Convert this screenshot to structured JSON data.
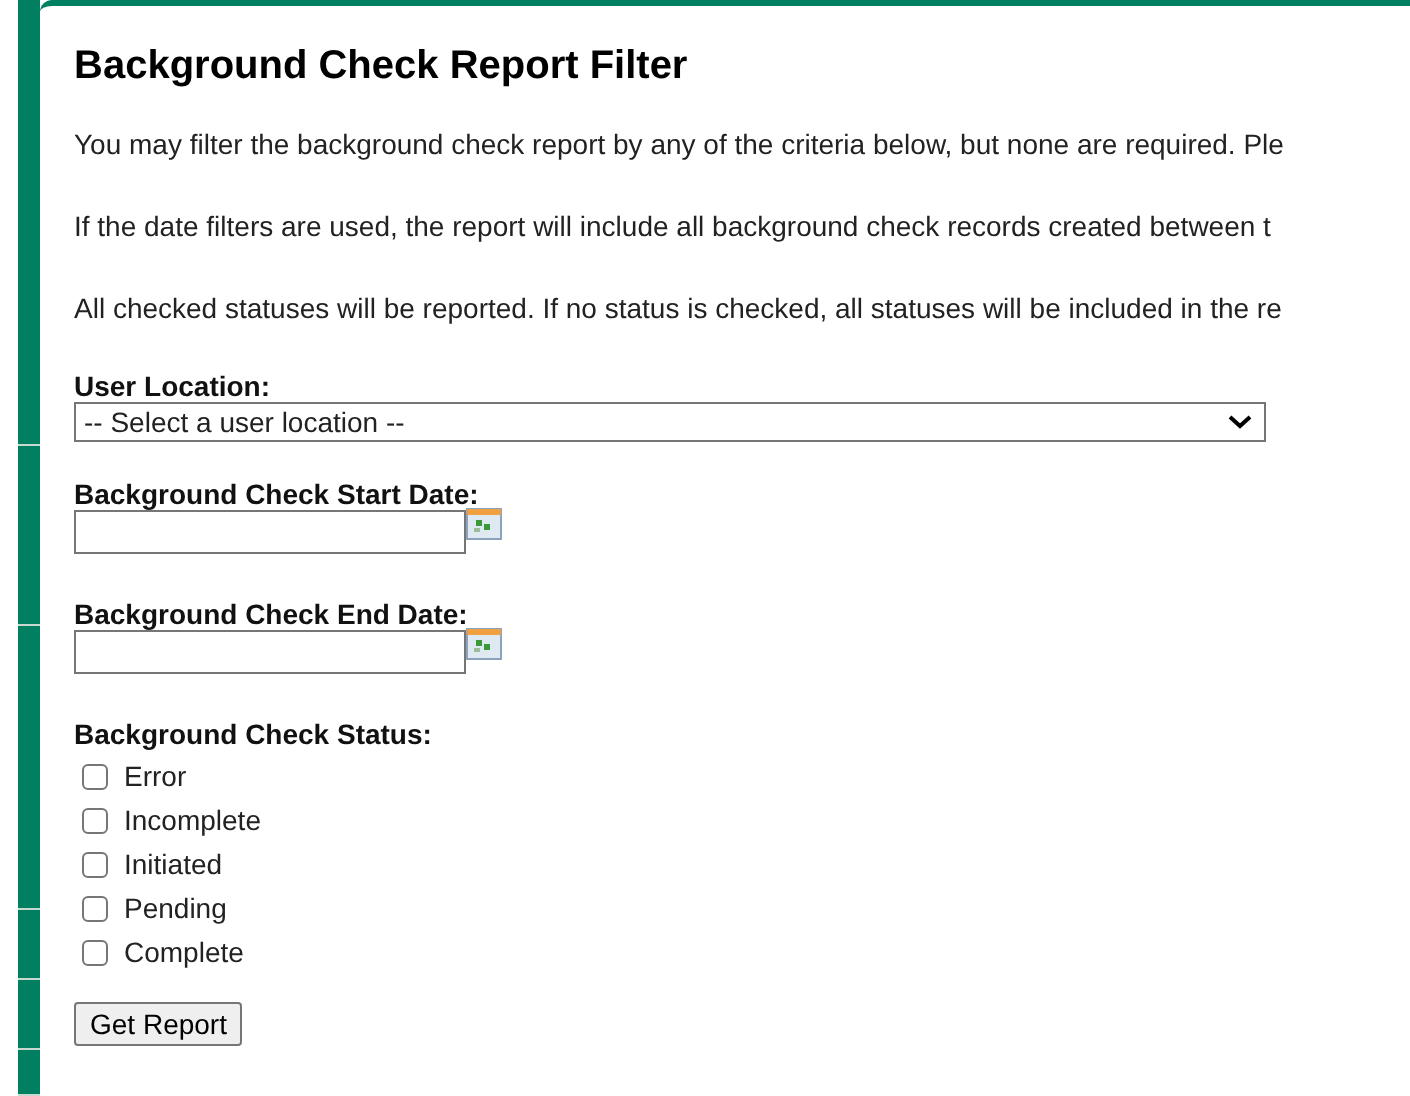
{
  "title": "Background Check Report Filter",
  "paragraphs": [
    "You may filter the background check report by any of the criteria below, but none are required. Ple",
    "If the date filters are used, the report will include all background check records created between t",
    "All checked statuses will be reported. If no status is checked, all statuses will be included in the re"
  ],
  "user_location": {
    "label": "User Location:",
    "value": "-- Select a user location --"
  },
  "date_fields": [
    {
      "label": "Background Check Start Date:"
    },
    {
      "label": "Background Check End Date:"
    }
  ],
  "status": {
    "label": "Background Check Status:",
    "options": [
      {
        "label": "Error",
        "checked": false
      },
      {
        "label": "Incomplete",
        "checked": false
      },
      {
        "label": "Initiated",
        "checked": false
      },
      {
        "label": "Pending",
        "checked": false
      },
      {
        "label": "Complete",
        "checked": false
      }
    ]
  },
  "submit_button": "Get Report"
}
